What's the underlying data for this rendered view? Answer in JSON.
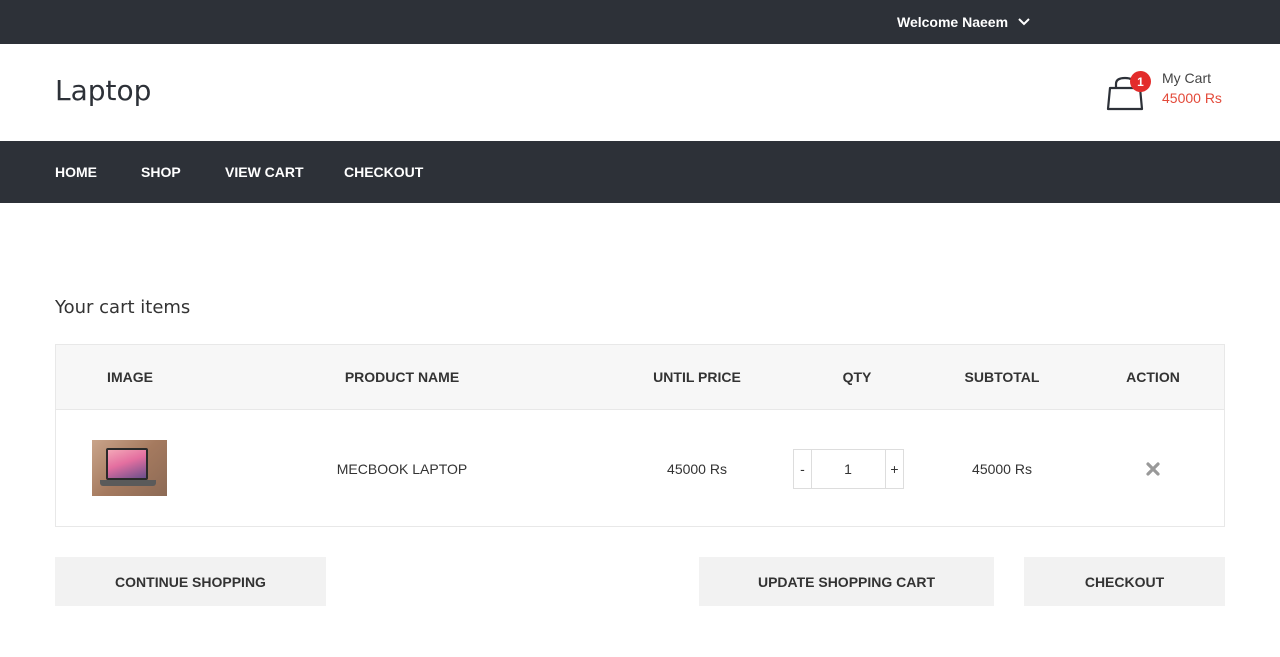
{
  "topbar": {
    "welcome_text": "Welcome Naeem"
  },
  "header": {
    "logo": "Laptop",
    "cart": {
      "count": "1",
      "label": "My Cart",
      "total": "45000 Rs"
    }
  },
  "nav": {
    "home": "HOME",
    "shop": "SHOP",
    "view_cart": "VIEW CART",
    "checkout": "CHECKOUT"
  },
  "main": {
    "title": "Your cart items",
    "columns": {
      "image": "IMAGE",
      "product_name": "PRODUCT NAME",
      "unit_price": "UNTIL PRICE",
      "qty": "QTY",
      "subtotal": "SUBTOTAL",
      "action": "ACTION"
    },
    "rows": [
      {
        "product_name": "MECBOOK LAPTOP",
        "unit_price": "45000 Rs",
        "qty": "1",
        "qty_minus": "-",
        "qty_plus": "+",
        "subtotal": "45000 Rs"
      }
    ]
  },
  "buttons": {
    "continue_shopping": "CONTINUE SHOPPING",
    "update_cart": "UPDATE SHOPPING CART",
    "checkout": "CHECKOUT"
  },
  "colors": {
    "dark_bar": "#2d3138",
    "badge": "#e32c2b",
    "price_accent": "#e34a3a",
    "button_bg": "#f2f2f2"
  },
  "icons": [
    "chevron-down-icon",
    "shopping-bag-icon",
    "close-icon"
  ]
}
